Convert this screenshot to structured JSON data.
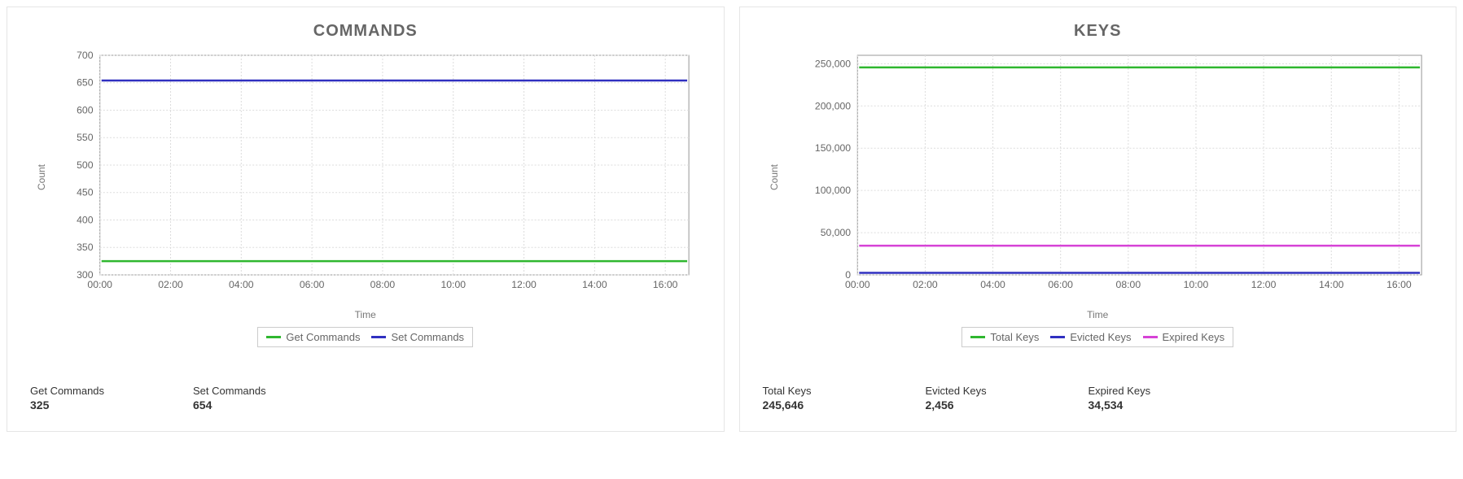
{
  "chart_data": [
    {
      "id": "commands",
      "type": "line",
      "title": "COMMANDS",
      "xlabel": "Time",
      "ylabel": "Count",
      "x_ticks": [
        "00:00",
        "02:00",
        "04:00",
        "06:00",
        "08:00",
        "10:00",
        "12:00",
        "14:00",
        "16:00"
      ],
      "y_ticks": [
        300,
        350,
        400,
        450,
        500,
        550,
        600,
        650,
        700
      ],
      "ylim": [
        300,
        700
      ],
      "series": [
        {
          "name": "Get Commands",
          "color": "#2fb72f",
          "constant_value": 325
        },
        {
          "name": "Set Commands",
          "color": "#3030c0",
          "constant_value": 654
        }
      ]
    },
    {
      "id": "keys",
      "type": "line",
      "title": "KEYS",
      "xlabel": "Time",
      "ylabel": "Count",
      "x_ticks": [
        "00:00",
        "02:00",
        "04:00",
        "06:00",
        "08:00",
        "10:00",
        "12:00",
        "14:00",
        "16:00"
      ],
      "y_ticks": [
        0,
        50000,
        100000,
        150000,
        200000,
        250000
      ],
      "ylim": [
        0,
        260000
      ],
      "series": [
        {
          "name": "Total Keys",
          "color": "#2fb72f",
          "constant_value": 245646
        },
        {
          "name": "Evicted Keys",
          "color": "#3030c0",
          "constant_value": 2456
        },
        {
          "name": "Expired Keys",
          "color": "#d642d6",
          "constant_value": 34534
        }
      ]
    }
  ],
  "panels": {
    "commands": {
      "title": "COMMANDS",
      "xlabel": "Time",
      "ylabel": "Count",
      "legend": [
        {
          "label": "Get Commands",
          "color": "#2fb72f"
        },
        {
          "label": "Set Commands",
          "color": "#3030c0"
        }
      ],
      "stats": [
        {
          "label": "Get Commands",
          "value": "325"
        },
        {
          "label": "Set Commands",
          "value": "654"
        }
      ]
    },
    "keys": {
      "title": "KEYS",
      "xlabel": "Time",
      "ylabel": "Count",
      "legend": [
        {
          "label": "Total Keys",
          "color": "#2fb72f"
        },
        {
          "label": "Evicted Keys",
          "color": "#3030c0"
        },
        {
          "label": "Expired Keys",
          "color": "#d642d6"
        }
      ],
      "stats": [
        {
          "label": "Total Keys",
          "value": "245,646"
        },
        {
          "label": "Evicted Keys",
          "value": "2,456"
        },
        {
          "label": "Expired Keys",
          "value": "34,534"
        }
      ]
    }
  }
}
